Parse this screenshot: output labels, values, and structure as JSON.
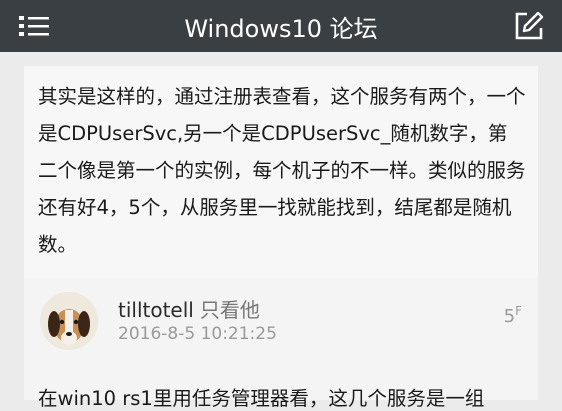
{
  "header": {
    "title": "Windows10 论坛",
    "menu_icon": "list-menu-icon",
    "edit_icon": "compose-icon",
    "bg_color": "#3a3f44"
  },
  "post_prev": {
    "text": "其实是这样的，通过注册表查看，这个服务有两个，一个是CDPUserSvc,另一个是CDPUserSvc_随机数字，第二个像是第一个的实例，每个机子的不一样。类似的服务还有好4，5个，从服务里一找就能找到，结尾都是随机数。"
  },
  "post_reply": {
    "username": "tilltotell",
    "only_him": "只看他",
    "time": "2016-8-5 10:21:25",
    "floor_num": "5",
    "floor_suffix": "F",
    "preview": "在win10 rs1里用任务管理器看，这几个服务是一组"
  }
}
